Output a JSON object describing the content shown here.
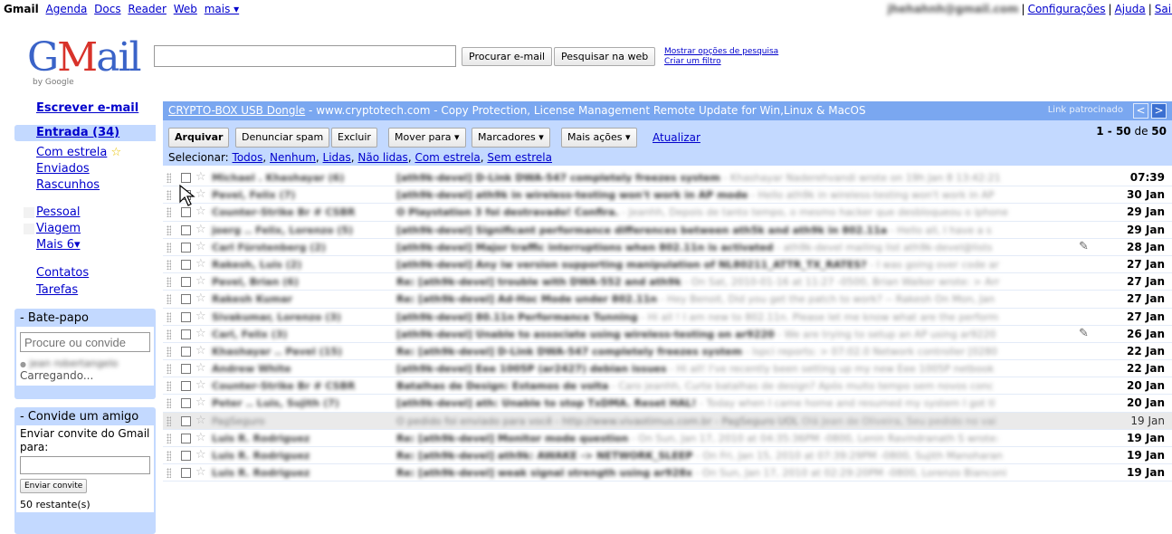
{
  "topbar": {
    "brand": "Gmail",
    "links": [
      "Agenda",
      "Docs",
      "Reader",
      "Web",
      "mais ▾"
    ],
    "account": "jhehahnh@gmail.com",
    "settings": "Configurações",
    "help": "Ajuda",
    "signout": "Sair"
  },
  "logo": {
    "g": "G",
    "m": "M",
    "ail": "ail",
    "by": "by Google"
  },
  "search": {
    "value": "",
    "search_mail": "Procurar e-mail",
    "search_web": "Pesquisar na web",
    "show_options": "Mostrar opções de pesquisa",
    "create_filter": "Criar um filtro"
  },
  "nav": {
    "compose": "Escrever e-mail",
    "inbox": "Entrada (34)",
    "starred": "Com estrela",
    "sent": "Enviados",
    "drafts": "Rascunhos",
    "labels": [
      "Pessoal",
      "Viagem"
    ],
    "more_labels": "Mais 6▾",
    "contacts": "Contatos",
    "tasks": "Tarefas"
  },
  "chat": {
    "title": "- Bate-papo",
    "placeholder": "Procure ou convide",
    "contact": "jean robertangelo",
    "status": "Carregando..."
  },
  "invite": {
    "title": "- Convide um amigo",
    "text": "Enviar convite do Gmail para:",
    "button": "Enviar convite",
    "remaining": "50 restante(s)"
  },
  "ad": {
    "link": "CRYPTO-BOX USB Dongle",
    "text": " - www.cryptotech.com - Copy Protection, License Management Remote Update for Win,Linux & MacOS",
    "sponsored": "Link patrocinado",
    "prev": "<",
    "next": ">"
  },
  "toolbar": {
    "archive": "Arquivar",
    "spam": "Denunciar spam",
    "delete": "Excluir",
    "move": "Mover para ▾",
    "labels": "Marcadores ▾",
    "more": "Mais ações ▾",
    "refresh": "Atualizar",
    "range": "1 - 50",
    "of": " de ",
    "total": "50",
    "select_label": "Selecionar: ",
    "select_options": [
      "Todos",
      "Nenhum",
      "Lidas",
      "Não lidas",
      "Com estrela",
      "Sem estrela"
    ]
  },
  "emails": [
    {
      "sender": "Michael . Khashayar (6)",
      "subject": "[ath9k-devel] D-Link DWA-547 completely freezes system",
      "snippet": " - Khashayar Naderehvandi wrote on 19h Jan 8 13:42:21",
      "date": "07:39",
      "read": false,
      "clip": false
    },
    {
      "sender": "Pavel, Felix (7)",
      "subject": "[ath9k-devel] ath9k in wireless-testing won't work in AP mode",
      "snippet": " - Hello ath9k in wireless-testing won't work in AP",
      "date": "30 Jan",
      "read": false,
      "clip": false
    },
    {
      "sender": "Counter-Strike Br # CSBR",
      "subject": "O Playstation 3 foi destravado! Confira.",
      "snippet": " - Jeanhh, Depois de tanto tempo, o mesmo hacker que desbloqueou o iphone",
      "date": "29 Jan",
      "read": false,
      "clip": false
    },
    {
      "sender": "joerg .. Felix, Lorenzo (5)",
      "subject": "[ath9k-devel] Significant performance differences between ath5k and ath9k in 802.11a",
      "snippet": " - Hello all, I have a s",
      "date": "29 Jan",
      "read": false,
      "clip": false
    },
    {
      "sender": "Carl Fürstenberg (2)",
      "subject": "[ath9k-devel] Major traffic interruptions when 802.11n is activated",
      "snippet": " - ath9k-devel mailing list ath9k-devel@lists",
      "date": "28 Jan",
      "read": false,
      "clip": true
    },
    {
      "sender": "Rakesh, Luis (2)",
      "subject": "[ath9k-devel] Any iw version supporting manipulation of NL80211_ATTR_TX_RATES?",
      "snippet": " - I was going over code ar",
      "date": "27 Jan",
      "read": false,
      "clip": false
    },
    {
      "sender": "Pavel, Brian (6)",
      "subject": "Re: [ath9k-devel] trouble with DWA-552 and ath9k",
      "snippet": " - On Sat, 2010-01-16 at 11:27 -0500, Brian Walker wrote: > Arr",
      "date": "27 Jan",
      "read": false,
      "clip": false
    },
    {
      "sender": "Rakesh Kumar",
      "subject": "Re: [ath9k-devel] Ad-Hoc Mode under 802.11n",
      "snippet": " - Hey Benoit, Did you get the patch to work? -- Rakesh On Mon, Jan",
      "date": "27 Jan",
      "read": false,
      "clip": false
    },
    {
      "sender": "Sivakumar, Lorenzo (3)",
      "subject": "[ath9k-devel] 80.11n Performance Tunning",
      "snippet": " - Hi all ! I am new to 802.11n. Please let me know what are the perform",
      "date": "27 Jan",
      "read": false,
      "clip": false
    },
    {
      "sender": "Carl, Felix (3)",
      "subject": "[ath9k-devel] Unable to associate using wireless-testing on ar9220",
      "snippet": " - We are trying to setup an AP using ar9220",
      "date": "26 Jan",
      "read": false,
      "clip": true
    },
    {
      "sender": "Khashayar .. Pavel (15)",
      "subject": "Re: [ath9k-devel] D-Link DWA-547 completely freezes system",
      "snippet": " - lspci reports: > 07:02.0 Network controller [0280",
      "date": "22 Jan",
      "read": false,
      "clip": false
    },
    {
      "sender": "Andrew White",
      "subject": "[ath9k-devel] Eee 1005P (ar2427) debian issues",
      "snippet": " - Hi all! I've recently been setting up my new Eee 1005P netbook",
      "date": "22 Jan",
      "read": false,
      "clip": false
    },
    {
      "sender": "Counter-Strike Br # CSBR",
      "subject": "Batalhas de Design: Estamos de volta",
      "snippet": " - Caro jeanhh, Curte batalhas de design? Após muito tempo sem novos conc",
      "date": "20 Jan",
      "read": false,
      "clip": false
    },
    {
      "sender": "Peter .. Luis, Sujith (7)",
      "subject": "[ath9k-devel] ath: Unable to stop TxDMA. Reset HAL!",
      "snippet": " - Today when I came home and resumed my system I got tl",
      "date": "20 Jan",
      "read": false,
      "clip": false
    },
    {
      "sender": "PagSeguro",
      "subject": "O pedido foi enviado para você - http://www.vivaotimus.com.br - PagSeguro UOL",
      "snippet": " Olá Jean de Oliveira, Seu pedido no vai",
      "date": "19 Jan",
      "read": true,
      "clip": false
    },
    {
      "sender": "Luis R. Rodriguez",
      "subject": "Re: [ath9k-devel] Monitor mode question",
      "snippet": " - On Sun, Jan 17, 2010 at 04:35:36PM -0800, Lenin Ravindranath S wrote:",
      "date": "19 Jan",
      "read": false,
      "clip": false
    },
    {
      "sender": "Luis R. Rodriguez",
      "subject": "Re: [ath9k-devel] ath9k: AWAKE -> NETWORK_SLEEP",
      "snippet": " - On Fri, Jan 15, 2010 at 07:39:29PM -0800, Sujith Manoharan",
      "date": "19 Jan",
      "read": false,
      "clip": false
    },
    {
      "sender": "Luis R. Rodriguez",
      "subject": "Re: [ath9k-devel] weak signal strength using ar928x",
      "snippet": " - On Sun, Jan 17, 2010 at 02:29:20PM -0800, Lorenzo Bianconi",
      "date": "19 Jan",
      "read": false,
      "clip": false
    }
  ]
}
